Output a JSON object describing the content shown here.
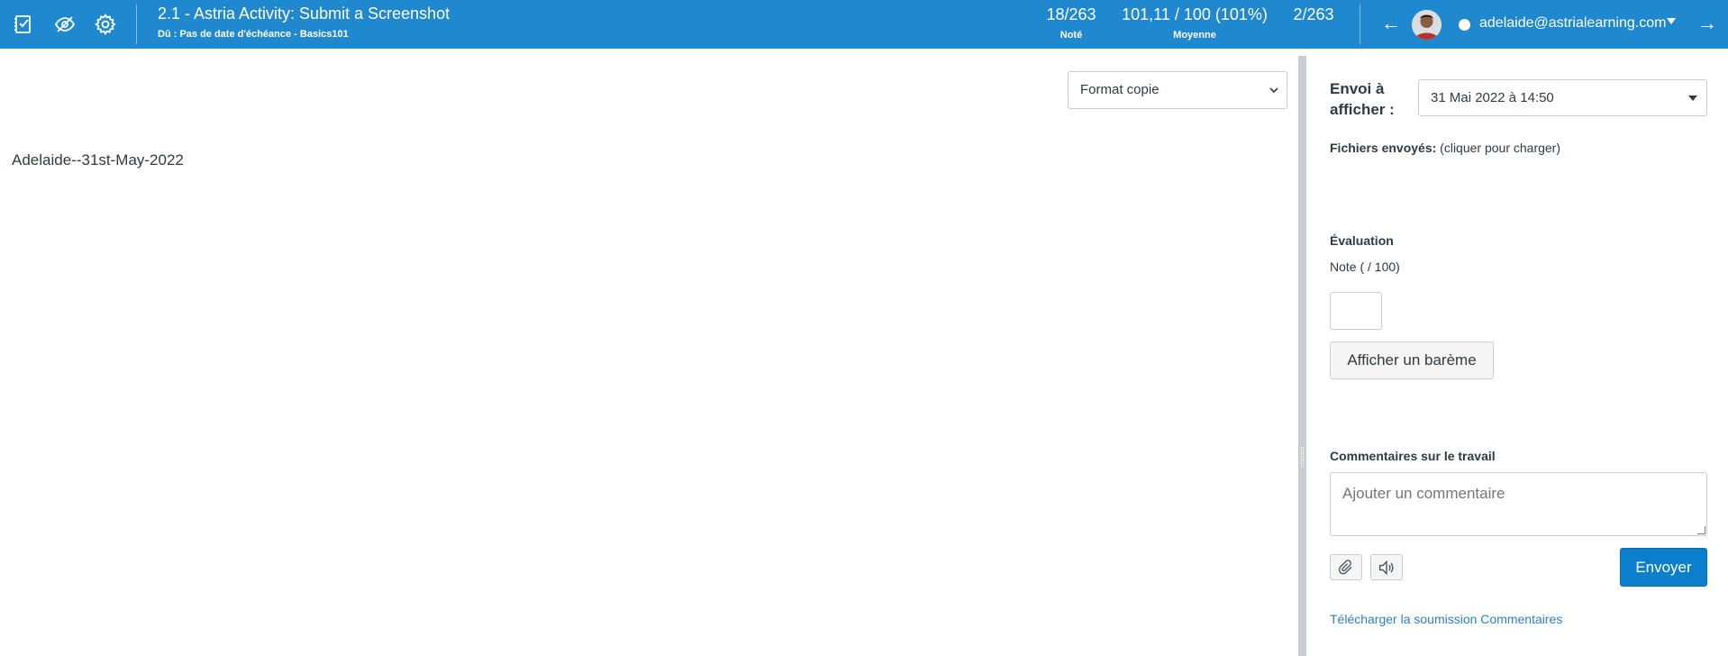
{
  "header": {
    "title": "2.1 - Astria Activity: Submit a Screenshot",
    "subtitle": "Dû : Pas de date d'échéance - Basics101",
    "graded": {
      "value": "18/263",
      "label": "Noté"
    },
    "average": {
      "value": "101,11 / 100 (101%)",
      "label": "Moyenne"
    },
    "position": "2/263",
    "prev_arrow": "←",
    "next_arrow": "→",
    "student_email": "adelaide@astrialearning.com",
    "icons": [
      "gradebook-icon",
      "hide-eye-icon",
      "gear-icon"
    ]
  },
  "viewer": {
    "format_select": "Format copie",
    "document_text": "Adelaide--31st-May-2022"
  },
  "panel": {
    "submission_label": "Envoi à afficher :",
    "submission_value": "31 Mai 2022 à 14:50",
    "files_label": "Fichiers envoyés:",
    "files_hint": "(cliquer pour charger)",
    "evaluation_heading": "Évaluation",
    "grade_label": "Note ( / 100)",
    "grade_value": "",
    "rubric_button": "Afficher un barème",
    "comments_heading": "Commentaires sur le travail",
    "comment_placeholder": "Ajouter un commentaire",
    "send_button": "Envoyer",
    "download_link": "Télécharger la soumission Commentaires"
  },
  "colors": {
    "header_bg": "#2088cf",
    "primary_button": "#0b7fcb",
    "link": "#2f7fc2"
  }
}
